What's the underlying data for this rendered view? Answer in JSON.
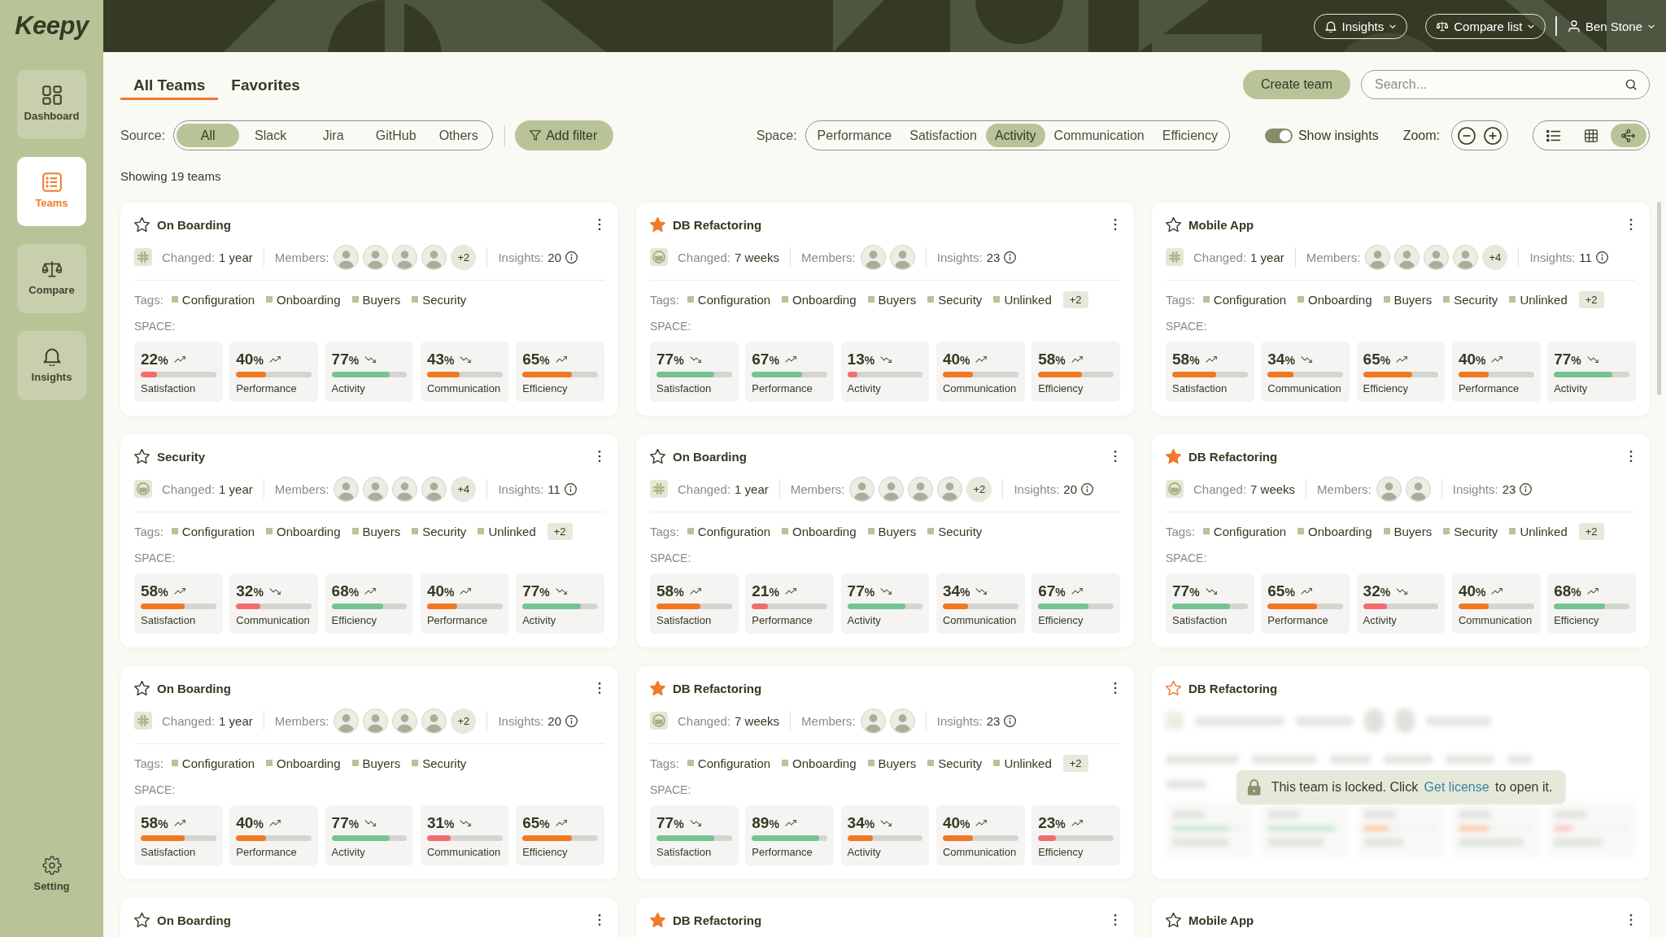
{
  "sidebar": {
    "logo": "Keepy",
    "items": [
      {
        "label": "Dashboard",
        "selected": false
      },
      {
        "label": "Teams",
        "selected": true
      },
      {
        "label": "Compare",
        "selected": false
      },
      {
        "label": "Insights",
        "selected": false
      }
    ],
    "footer": {
      "label": "Setting"
    }
  },
  "header": {
    "insights_menu": {
      "label": "Insights"
    },
    "compare_menu": {
      "label": "Compare list"
    },
    "user_menu": {
      "name": "Ben Stone"
    }
  },
  "tabs": [
    {
      "label": "All Teams",
      "selected": true
    },
    {
      "label": "Favorites",
      "selected": false
    }
  ],
  "create_button": "Create team",
  "search": {
    "placeholder": "Search..."
  },
  "source_filter": {
    "label": "Source:",
    "options": [
      {
        "label": "All",
        "selected": true
      },
      {
        "label": "Slack",
        "selected": false
      },
      {
        "label": "Jira",
        "selected": false
      },
      {
        "label": "GitHub",
        "selected": false
      },
      {
        "label": "Others",
        "selected": false
      }
    ]
  },
  "add_filter": "Add filter",
  "space_filter": {
    "label": "Space:",
    "options": [
      {
        "label": "Performance",
        "selected": false
      },
      {
        "label": "Satisfaction",
        "selected": false
      },
      {
        "label": "Activity",
        "selected": true
      },
      {
        "label": "Communication",
        "selected": false
      },
      {
        "label": "Efficiency",
        "selected": false
      }
    ]
  },
  "show_insights": {
    "label": "Show insights",
    "on": true
  },
  "zoom_label": "Zoom:",
  "view_modes": [
    {
      "selected": false
    },
    {
      "selected": false
    },
    {
      "selected": true
    }
  ],
  "summary": "Showing 19 teams",
  "cards": [
    {
      "title": "On Boarding",
      "favorite": false,
      "locked": false,
      "source": {
        "kind": "slack"
      },
      "changed_label": "Changed:",
      "changed": "1 year",
      "members_label": "Members:",
      "members": [
        {
          "kind": "photo"
        },
        {
          "kind": "photo"
        },
        {
          "kind": "photo"
        },
        {
          "kind": "photo"
        }
      ],
      "members_more": "+2",
      "insights_label": "Insights:",
      "insights": "20",
      "tags_label": "Tags:",
      "tags": [
        "Configuration",
        "Onboarding",
        "Buyers",
        "Security"
      ],
      "space_label": "SPACE:",
      "metrics": [
        {
          "value": "22",
          "unit": "%",
          "rising": true,
          "level": 0.22,
          "label": "Satisfaction"
        },
        {
          "value": "40",
          "unit": "%",
          "rising": true,
          "level": 0.4,
          "label": "Performance"
        },
        {
          "value": "77",
          "unit": "%",
          "rising": false,
          "level": 0.77,
          "label": "Activity"
        },
        {
          "value": "43",
          "unit": "%",
          "rising": false,
          "level": 0.43,
          "label": "Communication"
        },
        {
          "value": "65",
          "unit": "%",
          "rising": true,
          "level": 0.65,
          "label": "Efficiency"
        }
      ]
    },
    {
      "title": "DB Refactoring",
      "favorite": true,
      "locked": false,
      "source": {
        "kind": "github"
      },
      "changed_label": "Changed:",
      "changed": "7 weeks",
      "members_label": "Members:",
      "members": [
        {
          "kind": "photo"
        },
        {
          "kind": "photo"
        }
      ],
      "insights_label": "Insights:",
      "insights": "23",
      "tags_label": "Tags:",
      "tags": [
        "Configuration",
        "Onboarding",
        "Buyers",
        "Security",
        "Unlinked"
      ],
      "tags_more": "+2",
      "space_label": "SPACE:",
      "metrics": [
        {
          "value": "77",
          "unit": "%",
          "rising": false,
          "level": 0.77,
          "label": "Satisfaction"
        },
        {
          "value": "67",
          "unit": "%",
          "rising": true,
          "level": 0.67,
          "label": "Performance"
        },
        {
          "value": "13",
          "unit": "%",
          "rising": false,
          "level": 0.13,
          "label": "Activity"
        },
        {
          "value": "40",
          "unit": "%",
          "rising": true,
          "level": 0.4,
          "label": "Communication"
        },
        {
          "value": "58",
          "unit": "%",
          "rising": true,
          "level": 0.58,
          "label": "Efficiency"
        }
      ]
    },
    {
      "title": "Mobile App",
      "favorite": false,
      "locked": false,
      "source": {
        "kind": "slack"
      },
      "changed_label": "Changed:",
      "changed": "1 year",
      "members_label": "Members:",
      "members": [
        {
          "kind": "photo"
        },
        {
          "kind": "photo"
        },
        {
          "kind": "photo"
        },
        {
          "kind": "photo"
        }
      ],
      "members_more": "+4",
      "insights_label": "Insights:",
      "insights": "11",
      "tags_label": "Tags:",
      "tags": [
        "Configuration",
        "Onboarding",
        "Buyers",
        "Security",
        "Unlinked"
      ],
      "tags_more": "+2",
      "space_label": "SPACE:",
      "metrics": [
        {
          "value": "58",
          "unit": "%",
          "rising": true,
          "level": 0.58,
          "label": "Satisfaction"
        },
        {
          "value": "34",
          "unit": "%",
          "rising": false,
          "level": 0.34,
          "label": "Communication"
        },
        {
          "value": "65",
          "unit": "%",
          "rising": true,
          "level": 0.65,
          "label": "Efficiency"
        },
        {
          "value": "40",
          "unit": "%",
          "rising": true,
          "level": 0.4,
          "label": "Performance"
        },
        {
          "value": "77",
          "unit": "%",
          "rising": false,
          "level": 0.77,
          "label": "Activity"
        }
      ]
    },
    {
      "title": "Security",
      "favorite": false,
      "locked": false,
      "source": {
        "kind": "github"
      },
      "changed_label": "Changed:",
      "changed": "1 year",
      "members_label": "Members:",
      "members": [
        {
          "kind": "photo"
        },
        {
          "kind": "photo"
        },
        {
          "kind": "photo"
        },
        {
          "kind": "photo"
        }
      ],
      "members_more": "+4",
      "insights_label": "Insights:",
      "insights": "11",
      "tags_label": "Tags:",
      "tags": [
        "Configuration",
        "Onboarding",
        "Buyers",
        "Security",
        "Unlinked"
      ],
      "tags_more": "+2",
      "space_label": "SPACE:",
      "metrics": [
        {
          "value": "58",
          "unit": "%",
          "rising": true,
          "level": 0.58,
          "label": "Satisfaction"
        },
        {
          "value": "32",
          "unit": "%",
          "rising": false,
          "level": 0.32,
          "label": "Communication"
        },
        {
          "value": "68",
          "unit": "%",
          "rising": true,
          "level": 0.68,
          "label": "Efficiency"
        },
        {
          "value": "40",
          "unit": "%",
          "rising": true,
          "level": 0.4,
          "label": "Performance"
        },
        {
          "value": "77",
          "unit": "%",
          "rising": false,
          "level": 0.77,
          "label": "Activity"
        }
      ]
    },
    {
      "title": "On Boarding",
      "favorite": false,
      "locked": false,
      "source": {
        "kind": "slack"
      },
      "changed_label": "Changed:",
      "changed": "1 year",
      "members_label": "Members:",
      "members": [
        {
          "kind": "photo"
        },
        {
          "kind": "photo"
        },
        {
          "kind": "photo"
        },
        {
          "kind": "photo"
        }
      ],
      "members_more": "+2",
      "insights_label": "Insights:",
      "insights": "20",
      "tags_label": "Tags:",
      "tags": [
        "Configuration",
        "Onboarding",
        "Buyers",
        "Security"
      ],
      "space_label": "SPACE:",
      "metrics": [
        {
          "value": "58",
          "unit": "%",
          "rising": true,
          "level": 0.58,
          "label": "Satisfaction"
        },
        {
          "value": "21",
          "unit": "%",
          "rising": true,
          "level": 0.21,
          "label": "Performance"
        },
        {
          "value": "77",
          "unit": "%",
          "rising": false,
          "level": 0.77,
          "label": "Activity"
        },
        {
          "value": "34",
          "unit": "%",
          "rising": false,
          "level": 0.34,
          "label": "Communication"
        },
        {
          "value": "67",
          "unit": "%",
          "rising": true,
          "level": 0.67,
          "label": "Efficiency"
        }
      ]
    },
    {
      "title": "DB Refactoring",
      "favorite": true,
      "locked": false,
      "source": {
        "kind": "github"
      },
      "changed_label": "Changed:",
      "changed": "7 weeks",
      "members_label": "Members:",
      "members": [
        {
          "kind": "photo"
        },
        {
          "kind": "photo"
        }
      ],
      "insights_label": "Insights:",
      "insights": "23",
      "tags_label": "Tags:",
      "tags": [
        "Configuration",
        "Onboarding",
        "Buyers",
        "Security",
        "Unlinked"
      ],
      "tags_more": "+2",
      "space_label": "SPACE:",
      "metrics": [
        {
          "value": "77",
          "unit": "%",
          "rising": false,
          "level": 0.77,
          "label": "Satisfaction"
        },
        {
          "value": "65",
          "unit": "%",
          "rising": true,
          "level": 0.65,
          "label": "Performance"
        },
        {
          "value": "32",
          "unit": "%",
          "rising": false,
          "level": 0.32,
          "label": "Activity"
        },
        {
          "value": "40",
          "unit": "%",
          "rising": true,
          "level": 0.4,
          "label": "Communication"
        },
        {
          "value": "68",
          "unit": "%",
          "rising": true,
          "level": 0.68,
          "label": "Efficiency"
        }
      ]
    },
    {
      "title": "On Boarding",
      "favorite": false,
      "locked": false,
      "source": {
        "kind": "slack"
      },
      "changed_label": "Changed:",
      "changed": "1 year",
      "members_label": "Members:",
      "members": [
        {
          "kind": "photo"
        },
        {
          "kind": "photo"
        },
        {
          "kind": "photo"
        },
        {
          "kind": "photo"
        }
      ],
      "members_more": "+2",
      "insights_label": "Insights:",
      "insights": "20",
      "tags_label": "Tags:",
      "tags": [
        "Configuration",
        "Onboarding",
        "Buyers",
        "Security"
      ],
      "space_label": "SPACE:",
      "metrics": [
        {
          "value": "58",
          "unit": "%",
          "rising": true,
          "level": 0.58,
          "label": "Satisfaction"
        },
        {
          "value": "40",
          "unit": "%",
          "rising": true,
          "level": 0.4,
          "label": "Performance"
        },
        {
          "value": "77",
          "unit": "%",
          "rising": false,
          "level": 0.77,
          "label": "Activity"
        },
        {
          "value": "31",
          "unit": "%",
          "rising": false,
          "level": 0.31,
          "label": "Communication"
        },
        {
          "value": "65",
          "unit": "%",
          "rising": true,
          "level": 0.65,
          "label": "Efficiency"
        }
      ]
    },
    {
      "title": "DB Refactoring",
      "favorite": true,
      "locked": false,
      "source": {
        "kind": "github"
      },
      "changed_label": "Changed:",
      "changed": "7 weeks",
      "members_label": "Members:",
      "members": [
        {
          "kind": "photo"
        },
        {
          "kind": "photo"
        }
      ],
      "insights_label": "Insights:",
      "insights": "23",
      "tags_label": "Tags:",
      "tags": [
        "Configuration",
        "Onboarding",
        "Buyers",
        "Security",
        "Unlinked"
      ],
      "tags_more": "+2",
      "space_label": "SPACE:",
      "metrics": [
        {
          "value": "77",
          "unit": "%",
          "rising": false,
          "level": 0.77,
          "label": "Satisfaction"
        },
        {
          "value": "89",
          "unit": "%",
          "rising": true,
          "level": 0.89,
          "label": "Performance"
        },
        {
          "value": "34",
          "unit": "%",
          "rising": false,
          "level": 0.34,
          "label": "Activity"
        },
        {
          "value": "40",
          "unit": "%",
          "rising": true,
          "level": 0.4,
          "label": "Communication"
        },
        {
          "value": "23",
          "unit": "%",
          "rising": true,
          "level": 0.23,
          "label": "Efficiency"
        }
      ]
    },
    {
      "title": "DB Refactoring",
      "favorite": false,
      "locked": true,
      "notice": {
        "before": "This team is locked. Click",
        "link": "Get license",
        "after": "to open it."
      }
    },
    {
      "title": "On Boarding",
      "favorite": false,
      "locked": false
    },
    {
      "title": "DB Refactoring",
      "favorite": true,
      "locked": false
    },
    {
      "title": "Mobile App",
      "favorite": false,
      "locked": false
    }
  ]
}
